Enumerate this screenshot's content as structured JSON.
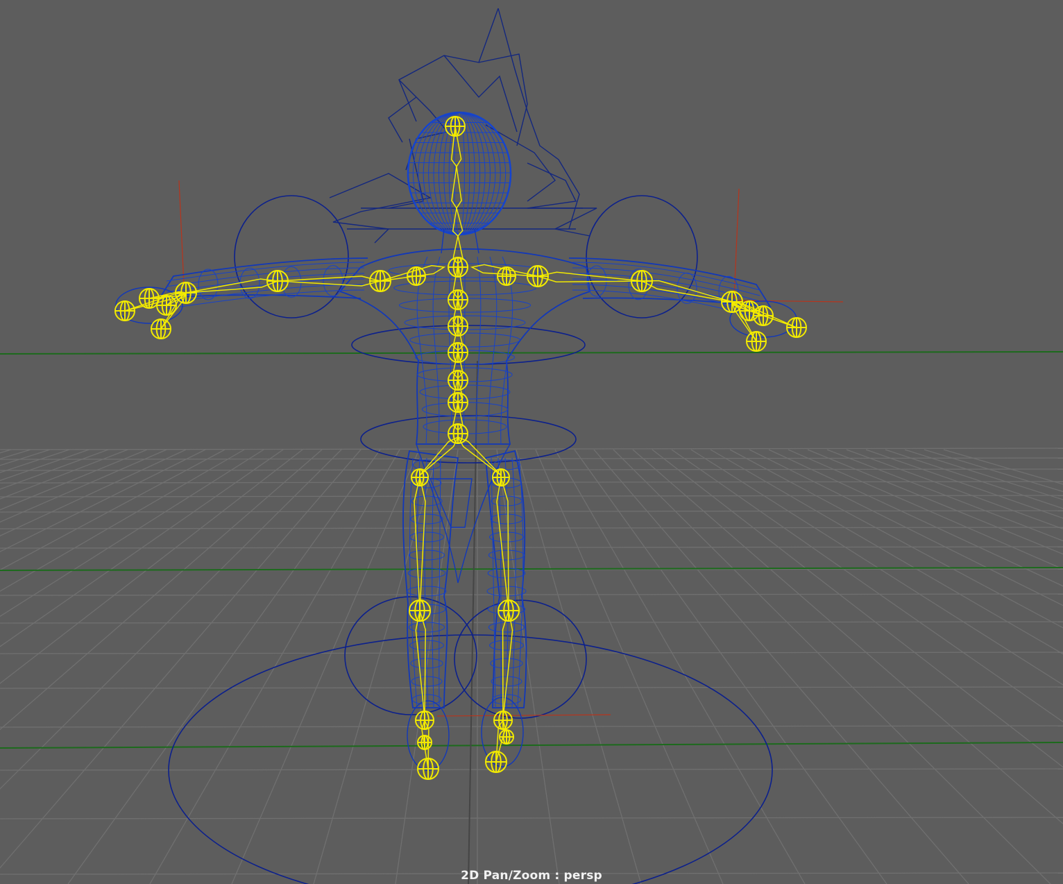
{
  "viewport": {
    "hud_label": "2D Pan/Zoom : persp",
    "camera": "persp"
  },
  "colors": {
    "background": "#5d5d5d",
    "grid": "#6f6f6f",
    "grid_axis": "#1e6b1e",
    "wireframe": "#1238b8",
    "control_curve": "#0b1f8a",
    "joints": "#f2ea00",
    "locator": "#b8341c"
  },
  "icons": {
    "skeleton": "joint-icon",
    "mesh": "wireframe-mesh-icon",
    "controls": "nurbs-circle-icon"
  }
}
